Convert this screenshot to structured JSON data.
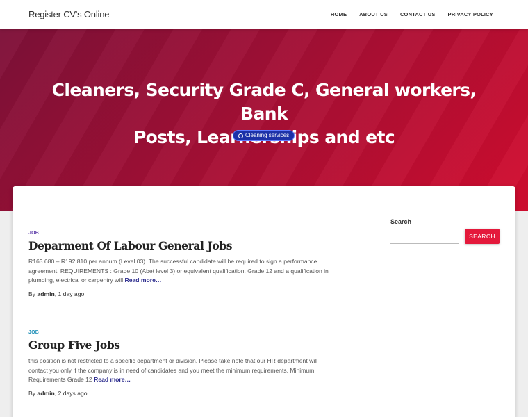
{
  "site": {
    "title": "Register CV's Online"
  },
  "nav": {
    "items": [
      {
        "label": "HOME"
      },
      {
        "label": "ABOUT US"
      },
      {
        "label": "CONTACT US"
      },
      {
        "label": "PRIVACY POLICY"
      }
    ]
  },
  "hero": {
    "title_line1": "Cleaners, Security Grade C, General workers, Bank",
    "title_line2": "Posts, Learnerships and etc",
    "badge_label": "Cleaning services",
    "badge_icon": "circle-dot-icon"
  },
  "posts": [
    {
      "category": "JOB",
      "title": "Deparment Of Labour General Jobs",
      "excerpt": "R163 680 – R192 810.per annum (Level 03). The successful candidate will be required to sign a performance agreement. REQUIREMENTS : Grade 10 (Abet level 3) or equivalent qualification. Grade 12 and a qualification in plumbing, electrical or carpentry will",
      "read_more": "Read more…",
      "meta_prefix": "By",
      "author": "admin",
      "date": "1 day ago"
    },
    {
      "category": "JOB",
      "title": "Group Five Jobs",
      "excerpt": "this position is not restricted to a specific department or division. Please take note that our HR department will contact you only if the company is in need of candidates and you meet the minimum requirements. Minimum Requirements Grade 12",
      "read_more": "Read more…",
      "meta_prefix": "By",
      "author": "admin",
      "date": "2 days ago"
    }
  ],
  "sidebar": {
    "search_heading": "Search",
    "search_placeholder": "",
    "search_button": "SEARCH"
  },
  "colors": {
    "accent": "#e4193b",
    "hero_start": "#7d1038",
    "hero_end": "#d30c2f",
    "badge": "#1c31a8",
    "category_purple": "#5b3aa8",
    "category_blue": "#1e8fb7"
  }
}
